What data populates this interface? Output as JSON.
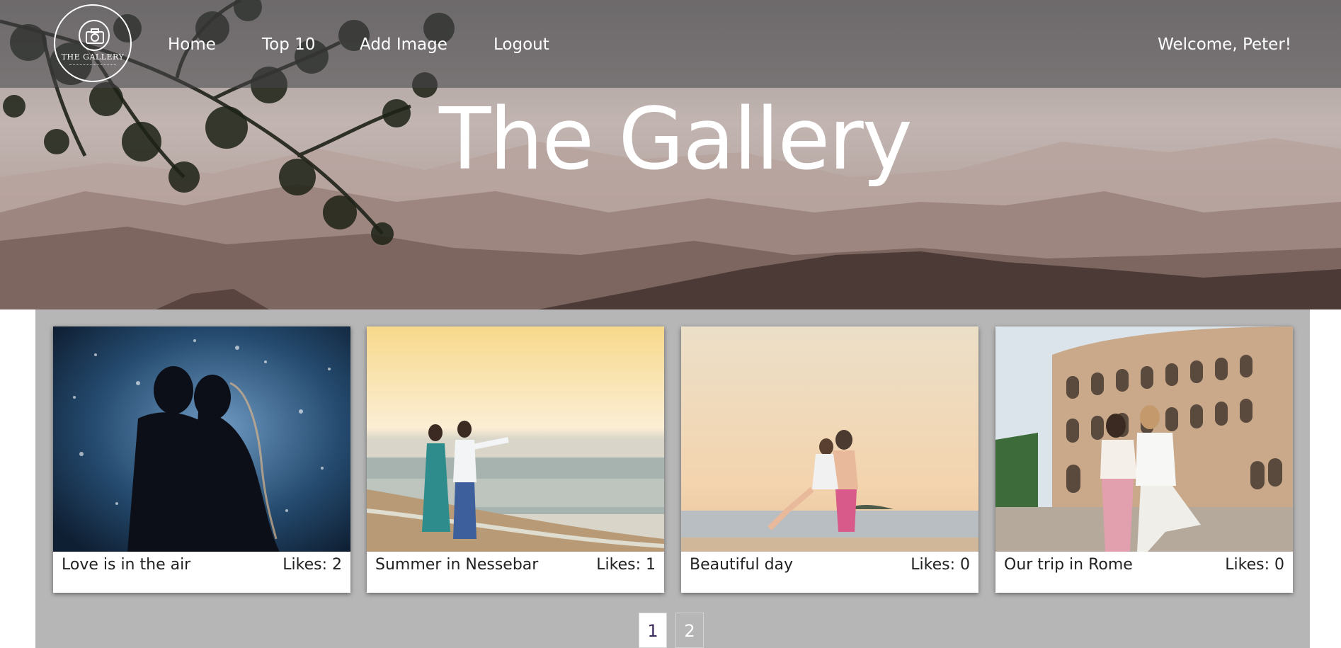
{
  "nav": {
    "logo_text": "THE GALLERY",
    "links": [
      "Home",
      "Top 10",
      "Add Image",
      "Logout"
    ],
    "welcome": "Welcome, Peter!"
  },
  "hero": {
    "title": "The Gallery"
  },
  "cards": [
    {
      "title": "Love is in the air",
      "likes": "Likes: 2"
    },
    {
      "title": "Summer in Nessebar",
      "likes": "Likes: 1"
    },
    {
      "title": "Beautiful day",
      "likes": "Likes: 0"
    },
    {
      "title": "Our trip in Rome",
      "likes": "Likes: 0"
    }
  ],
  "pagination": {
    "pages": [
      "1",
      "2"
    ],
    "current": "1"
  },
  "colors": {
    "topbar": "#4d4d50",
    "gallery_bg": "#b6b6b6",
    "card_bg": "#ffffff",
    "active_page_text": "#3d2a5c"
  },
  "icons": {
    "logo": "camera-icon"
  }
}
